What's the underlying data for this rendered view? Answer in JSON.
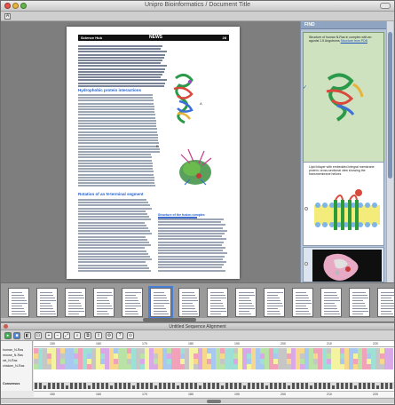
{
  "window": {
    "title": "Unipro Bioinformatics / Document Title"
  },
  "toolstrip": {
    "icon": "document-icon"
  },
  "page": {
    "header_left": "Science Hub",
    "header_mid": "NEWS",
    "header_right": "28",
    "section_heading": "Hydrophobic protein interactions",
    "subheading": "Rotation of an N-terminal segment",
    "figure_a_label": "A",
    "figure_b_label": "B",
    "caption_heading": "Structure of the fusion complex"
  },
  "sidebar": {
    "header": "FIND",
    "cards": [
      {
        "text": "Structure of human N-Ras in complex with an agonist 1.5 Angstroms",
        "link": "Structure from PDB"
      },
      {
        "text": "Lipid bilayer with embedded integral membrane protein; cross-sectional view showing the transmembrane helices",
        "link": ""
      },
      {
        "text": "",
        "link": ""
      }
    ]
  },
  "thumbnails": {
    "count": 14,
    "selected_index": 5
  },
  "alignment": {
    "panel_title": "Untitled Sequence Alignment",
    "sequences": [
      "human_N-Ras",
      "mouse_N-Ras",
      "rat_N-Ras",
      "chicken_N-Ras"
    ],
    "consensus_label": "Consensus",
    "ruler_ticks": [
      "150",
      "160",
      "170",
      "180",
      "190",
      "200",
      "210",
      "220"
    ],
    "bottom_ticks": [
      "150",
      "160",
      "170",
      "180",
      "190",
      "200",
      "210",
      "220"
    ],
    "residue_colors": [
      "#f2a2b8",
      "#b8e2a6",
      "#a9c8f0",
      "#f7d78c",
      "#d9a8e6",
      "#f4f4a0",
      "#c6c6c6",
      "#9fe0d6"
    ]
  }
}
